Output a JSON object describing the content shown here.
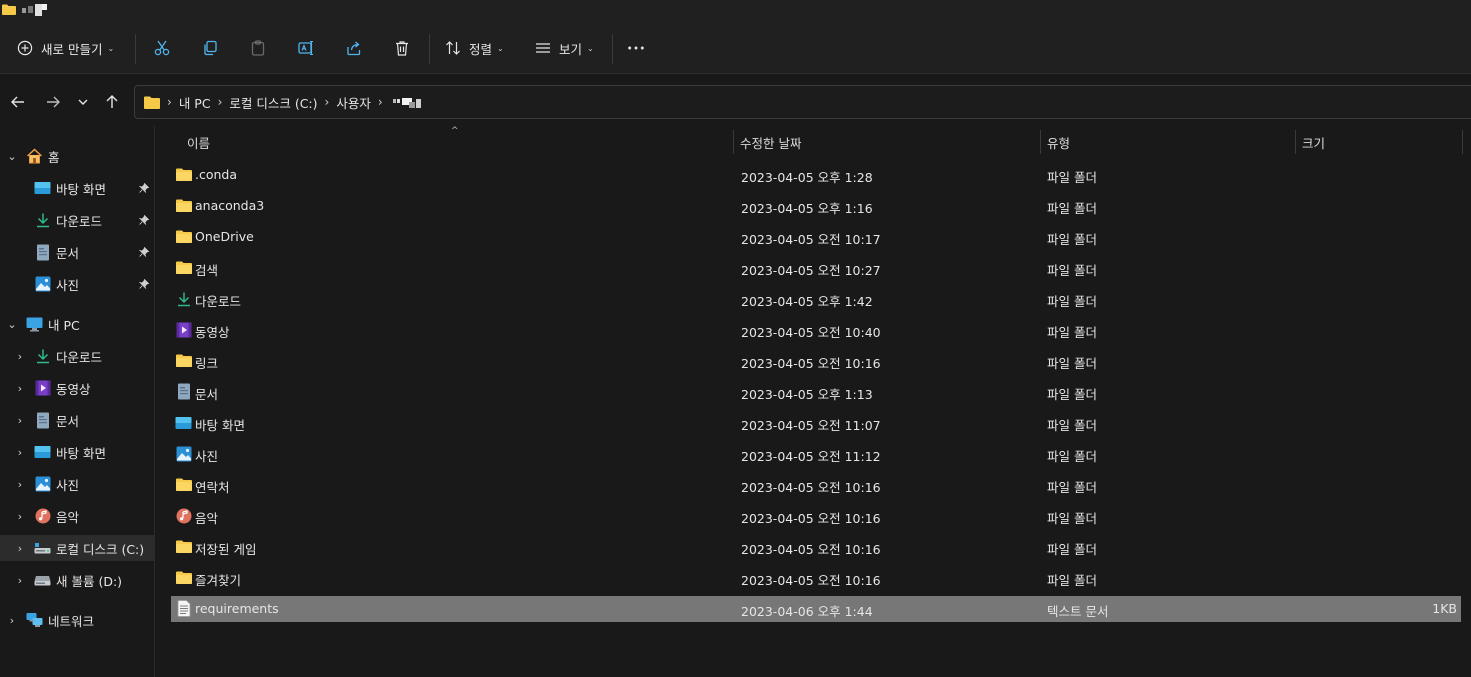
{
  "window": {
    "title_blurred": true
  },
  "toolbar": {
    "new_label": "새로 만들기",
    "sort_label": "정렬",
    "view_label": "보기"
  },
  "address": {
    "crumbs": [
      "내 PC",
      "로컬 디스크 (C:)",
      "사용자"
    ],
    "user_blurred": true
  },
  "sidebar": {
    "home": {
      "label": "홈"
    },
    "quick": [
      {
        "label": "바탕 화면",
        "icon": "desktop-icon",
        "pinned": true
      },
      {
        "label": "다운로드",
        "icon": "download-icon",
        "pinned": true
      },
      {
        "label": "문서",
        "icon": "document-icon",
        "pinned": true
      },
      {
        "label": "사진",
        "icon": "pictures-icon",
        "pinned": true
      }
    ],
    "pc": {
      "label": "내 PC"
    },
    "pc_items": [
      {
        "label": "다운로드",
        "icon": "download-icon"
      },
      {
        "label": "동영상",
        "icon": "videos-icon"
      },
      {
        "label": "문서",
        "icon": "document-icon"
      },
      {
        "label": "바탕 화면",
        "icon": "desktop-icon"
      },
      {
        "label": "사진",
        "icon": "pictures-icon"
      },
      {
        "label": "음악",
        "icon": "music-icon"
      },
      {
        "label": "로컬 디스크 (C:)",
        "icon": "drive-c-icon",
        "selected": true
      },
      {
        "label": "새 볼륨 (D:)",
        "icon": "drive-icon"
      }
    ],
    "network": {
      "label": "네트워크"
    }
  },
  "columns": {
    "name": "이름",
    "date": "수정한 날짜",
    "type": "유형",
    "size": "크기"
  },
  "files": [
    {
      "name": ".conda",
      "date": "2023-04-05 오후 1:28",
      "type": "파일 폴더",
      "size": "",
      "icon": "folder-icon"
    },
    {
      "name": "anaconda3",
      "date": "2023-04-05 오후 1:16",
      "type": "파일 폴더",
      "size": "",
      "icon": "folder-icon"
    },
    {
      "name": "OneDrive",
      "date": "2023-04-05 오전 10:17",
      "type": "파일 폴더",
      "size": "",
      "icon": "folder-icon"
    },
    {
      "name": "검색",
      "date": "2023-04-05 오전 10:27",
      "type": "파일 폴더",
      "size": "",
      "icon": "folder-icon"
    },
    {
      "name": "다운로드",
      "date": "2023-04-05 오후 1:42",
      "type": "파일 폴더",
      "size": "",
      "icon": "download-icon"
    },
    {
      "name": "동영상",
      "date": "2023-04-05 오전 10:40",
      "type": "파일 폴더",
      "size": "",
      "icon": "videos-icon"
    },
    {
      "name": "링크",
      "date": "2023-04-05 오전 10:16",
      "type": "파일 폴더",
      "size": "",
      "icon": "folder-icon"
    },
    {
      "name": "문서",
      "date": "2023-04-05 오후 1:13",
      "type": "파일 폴더",
      "size": "",
      "icon": "document-icon"
    },
    {
      "name": "바탕 화면",
      "date": "2023-04-05 오전 11:07",
      "type": "파일 폴더",
      "size": "",
      "icon": "desktop-icon"
    },
    {
      "name": "사진",
      "date": "2023-04-05 오전 11:12",
      "type": "파일 폴더",
      "size": "",
      "icon": "pictures-icon"
    },
    {
      "name": "연락처",
      "date": "2023-04-05 오전 10:16",
      "type": "파일 폴더",
      "size": "",
      "icon": "folder-icon"
    },
    {
      "name": "음악",
      "date": "2023-04-05 오전 10:16",
      "type": "파일 폴더",
      "size": "",
      "icon": "music-icon"
    },
    {
      "name": "저장된 게임",
      "date": "2023-04-05 오전 10:16",
      "type": "파일 폴더",
      "size": "",
      "icon": "folder-icon"
    },
    {
      "name": "즐겨찾기",
      "date": "2023-04-05 오전 10:16",
      "type": "파일 폴더",
      "size": "",
      "icon": "folder-icon"
    },
    {
      "name": "requirements",
      "date": "2023-04-06 오후 1:44",
      "type": "텍스트 문서",
      "size": "1KB",
      "icon": "text-file-icon",
      "selected": true
    }
  ],
  "colors": {
    "folder": "#F7C948",
    "selection": "#777777",
    "background": "#191919",
    "toolbar": "#202020"
  }
}
